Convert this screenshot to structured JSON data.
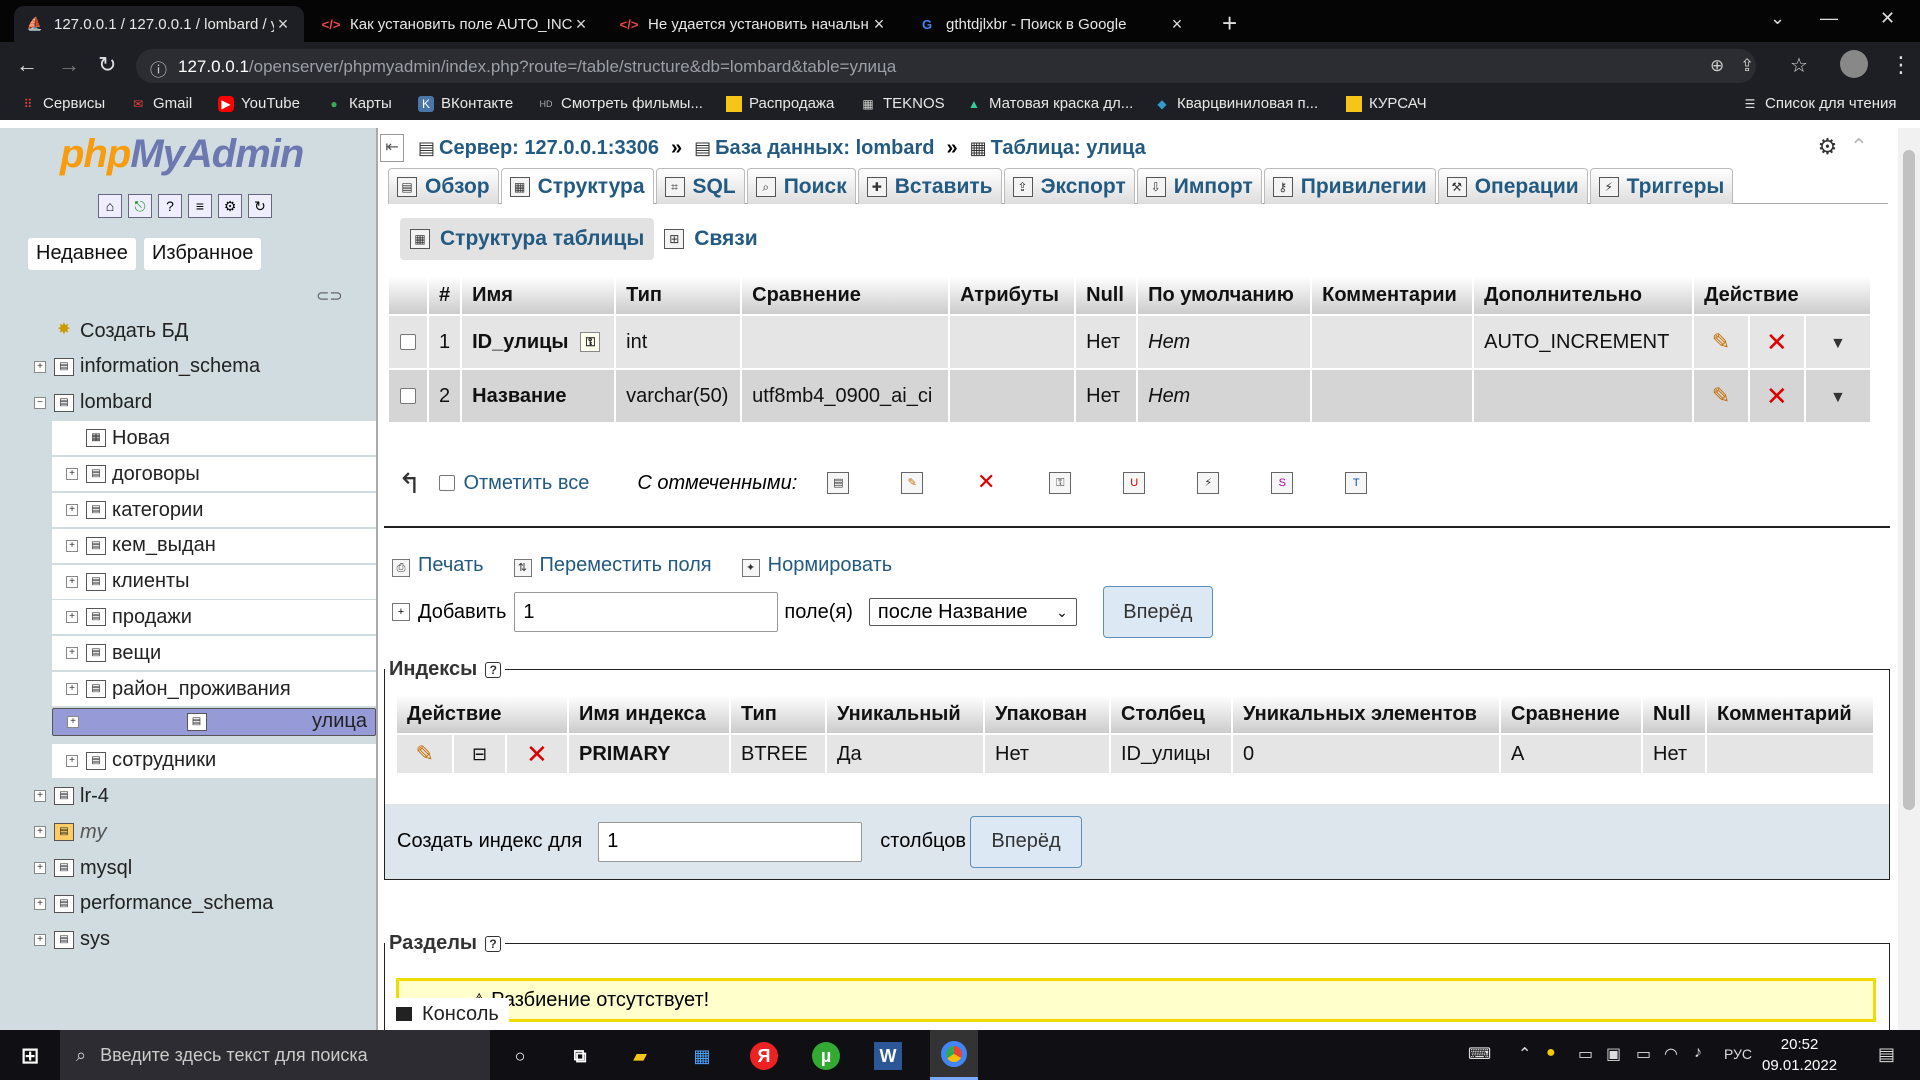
{
  "browser": {
    "tabs": [
      {
        "title": "127.0.0.1 / 127.0.0.1 / lombard / у",
        "active": true
      },
      {
        "title": "Как установить поле AUTO_INCF",
        "active": false
      },
      {
        "title": "Не удается установить начальн",
        "active": false
      },
      {
        "title": "gthtdjlxbr - Поиск в Google",
        "active": false
      }
    ],
    "url_host": "127.0.0.1",
    "url_path": "/openserver/phpmyadmin/index.php?route=/table/structure&db=lombard&table=улица",
    "bookmarks": [
      {
        "label": "Сервисы",
        "icon": "apps-icon"
      },
      {
        "label": "Gmail",
        "icon": "gmail-icon"
      },
      {
        "label": "YouTube",
        "icon": "youtube-icon"
      },
      {
        "label": "Карты",
        "icon": "maps-icon"
      },
      {
        "label": "ВКонтакте",
        "icon": "vk-icon"
      },
      {
        "label": "Смотреть фильмы...",
        "icon": "hd-icon"
      },
      {
        "label": "Распродажа",
        "icon": "folder-icon"
      },
      {
        "label": "TEKNOS",
        "icon": "teknos-icon"
      },
      {
        "label": "Матовая краска дл...",
        "icon": "paint-icon"
      },
      {
        "label": "Кварцвиниловая п...",
        "icon": "quartz-icon"
      },
      {
        "label": "КУРСАЧ",
        "icon": "folder-icon"
      }
    ],
    "reading_list": "Список для чтения"
  },
  "nav": {
    "logo_a": "php",
    "logo_b": "MyAdmin",
    "recent": "Недавнее",
    "favorites": "Избранное",
    "tree": [
      {
        "label": "Создать БД",
        "level": 0,
        "expander": false
      },
      {
        "label": "information_schema",
        "level": 0,
        "expander": true
      },
      {
        "label": "lombard",
        "level": 0,
        "expander": true,
        "open": true
      },
      {
        "label": "Новая",
        "level": 1,
        "expander": false
      },
      {
        "label": "договоры",
        "level": 1,
        "expander": true
      },
      {
        "label": "категории",
        "level": 1,
        "expander": true
      },
      {
        "label": "кем_выдан",
        "level": 1,
        "expander": true
      },
      {
        "label": "клиенты",
        "level": 1,
        "expander": true
      },
      {
        "label": "продажи",
        "level": 1,
        "expander": true
      },
      {
        "label": "вещи",
        "level": 1,
        "expander": true
      },
      {
        "label": "район_проживания",
        "level": 1,
        "expander": true
      },
      {
        "label": "улица",
        "level": 1,
        "expander": true,
        "selected": true
      },
      {
        "label": "сотрудники",
        "level": 1,
        "expander": true
      },
      {
        "label": "lr-4",
        "level": 0,
        "expander": true
      },
      {
        "label": "my",
        "level": 0,
        "expander": true,
        "italic": true
      },
      {
        "label": "mysql",
        "level": 0,
        "expander": true
      },
      {
        "label": "performance_schema",
        "level": 0,
        "expander": true
      },
      {
        "label": "sys",
        "level": 0,
        "expander": true
      }
    ]
  },
  "breadcrumb": {
    "server": "Сервер: 127.0.0.1:3306",
    "database": "База данных: lombard",
    "table": "Таблица: улица",
    "sep": "»"
  },
  "tabs": [
    {
      "label": "Обзор",
      "icon": "browse-icon"
    },
    {
      "label": "Структура",
      "icon": "structure-icon",
      "active": true
    },
    {
      "label": "SQL",
      "icon": "sql-icon"
    },
    {
      "label": "Поиск",
      "icon": "search-icon"
    },
    {
      "label": "Вставить",
      "icon": "insert-icon"
    },
    {
      "label": "Экспорт",
      "icon": "export-icon"
    },
    {
      "label": "Импорт",
      "icon": "import-icon"
    },
    {
      "label": "Привилегии",
      "icon": "privileges-icon"
    },
    {
      "label": "Операции",
      "icon": "operations-icon"
    },
    {
      "label": "Триггеры",
      "icon": "triggers-icon"
    }
  ],
  "subtabs": {
    "structure": "Структура таблицы",
    "relations": "Связи"
  },
  "structure": {
    "headers": [
      "#",
      "Имя",
      "Тип",
      "Сравнение",
      "Атрибуты",
      "Null",
      "По умолчанию",
      "Комментарии",
      "Дополнительно",
      "Действие"
    ],
    "rows": [
      {
        "num": "1",
        "name": "ID_улицы",
        "type": "int",
        "collation": "",
        "attributes": "",
        "null": "Нет",
        "default": "Нет",
        "comments": "",
        "extra": "AUTO_INCREMENT",
        "primary": true
      },
      {
        "num": "2",
        "name": "Название",
        "type": "varchar(50)",
        "collation": "utf8mb4_0900_ai_ci",
        "attributes": "",
        "null": "Нет",
        "default": "Нет",
        "comments": "",
        "extra": "",
        "primary": false
      }
    ]
  },
  "bulk": {
    "check_all": "Отметить все",
    "with_selected": "С отмеченными:"
  },
  "links": {
    "print": "Печать",
    "move": "Переместить поля",
    "normalize": "Нормировать"
  },
  "add_field": {
    "label": "Добавить",
    "value": "1",
    "unit": "поле(я)",
    "position": "после Название",
    "go": "Вперёд"
  },
  "indexes": {
    "legend": "Индексы",
    "headers": [
      "Действие",
      "Имя индекса",
      "Тип",
      "Уникальный",
      "Упакован",
      "Столбец",
      "Уникальных элементов",
      "Сравнение",
      "Null",
      "Комментарий"
    ],
    "row": {
      "name": "PRIMARY",
      "type": "BTREE",
      "unique": "Да",
      "packed": "Нет",
      "column": "ID_улицы",
      "cardinality": "0",
      "collation": "A",
      "null": "Нет",
      "comment": ""
    }
  },
  "create_index": {
    "label": "Создать индекс для",
    "value": "1",
    "unit": "столбцов",
    "go": "Вперёд"
  },
  "partitions": {
    "legend": "Разделы",
    "notice": "Разбиение отсутствует!"
  },
  "console": "Консоль",
  "taskbar": {
    "search_placeholder": "Введите здесь текст для поиска",
    "lang": "РУС",
    "time": "20:52",
    "date": "09.01.2022"
  }
}
